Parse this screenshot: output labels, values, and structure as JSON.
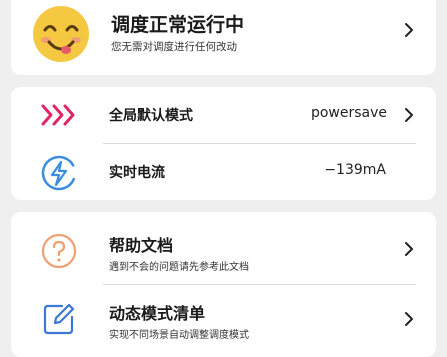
{
  "status": {
    "title": "调度正常运行中",
    "subtitle": "您无需对调度进行任何改动",
    "icon": "smiley-face-icon",
    "icon_color": "#f5c842"
  },
  "mode_card": {
    "global_mode": {
      "label": "全局默认模式",
      "value": "powersave",
      "icon": "triple-chevron-icon",
      "icon_color": "#e0246a"
    },
    "current": {
      "label": "实时电流",
      "value": "−139mA",
      "icon": "lightning-bolt-icon",
      "icon_color": "#3b8de0"
    }
  },
  "help_card": {
    "docs": {
      "title": "帮助文档",
      "subtitle": "遇到不会的问题请先参考此文档",
      "icon": "question-circle-icon",
      "icon_color": "#f0a070"
    },
    "mode_list": {
      "title": "动态模式清单",
      "subtitle": "实现不同场景自动调整调度模式",
      "icon": "edit-note-icon",
      "icon_color": "#3b78d8"
    }
  }
}
